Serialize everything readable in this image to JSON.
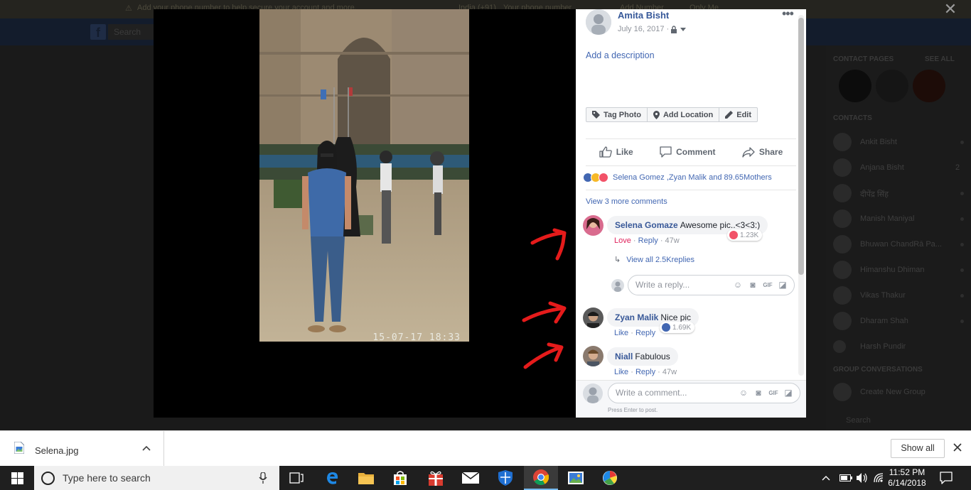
{
  "background": {
    "banner_text": "Add your phone number to help secure your account and more.",
    "banner_country": "India (+91)",
    "banner_placeholder": "Your phone number",
    "banner_add": "Add Number",
    "banner_only_me": "Only Me",
    "search_placeholder": "Search",
    "contact_pages_label": "CONTACT PAGES",
    "see_all": "SEE ALL",
    "contacts_label": "CONTACTS",
    "contacts": [
      "Ankit Bisht",
      "Anjana Bisht",
      "दीपेंद्र सिंह",
      "Manish Maniyal",
      "Bhuwan ChandRā Pa...",
      "Himanshu Dhiman",
      "Vikas Thakur",
      "Dharam Shah",
      "Harsh Pundir"
    ],
    "contact_badge": "2",
    "group_label": "GROUP CONVERSATIONS",
    "create_group": "Create New Group",
    "chat_search": "Search"
  },
  "post": {
    "owner": "Amita Bisht",
    "date": "July 16, 2017 ·",
    "add_description": "Add a description",
    "tools": [
      "Tag Photo",
      "Add Location",
      "Edit"
    ],
    "actions": [
      "Like",
      "Comment",
      "Share"
    ],
    "reactions_text": "Selena Gomez ,Zyan Malik and 89.65Mothers",
    "view_more_comments": "View 3 more comments",
    "photo_timestamp": "15-07-17 18:33"
  },
  "comments": [
    {
      "author": "Selena Gomaze",
      "text": "Awesome pic..<3<3:)",
      "reaction_count": "1.23K",
      "reaction_type": "love",
      "meta_first": "Love",
      "reply": "Reply",
      "age": "47w",
      "view_replies": "View all 2.5Kreplies"
    },
    {
      "author": "Zyan Malik",
      "text": "Nice pic",
      "reaction_count": "1.69K",
      "reaction_type": "like",
      "meta_first": "Like",
      "reply": "Reply",
      "age": ""
    },
    {
      "author": "Niall",
      "text": "Fabulous",
      "meta_first": "Like",
      "reply": "Reply",
      "age": "47w"
    }
  ],
  "reply_placeholder": "Write a reply...",
  "comment_placeholder": "Write a comment...",
  "press_enter": "Press Enter to post.",
  "download": {
    "file_name": "Selena.jpg",
    "show_all": "Show all"
  },
  "taskbar": {
    "search_placeholder": "Type here to search",
    "time": "11:52 PM",
    "date": "6/14/2018"
  },
  "colors": {
    "fb_blue": "#4267b2",
    "love": "#e0245e",
    "arrow_red": "#e51b1b"
  }
}
